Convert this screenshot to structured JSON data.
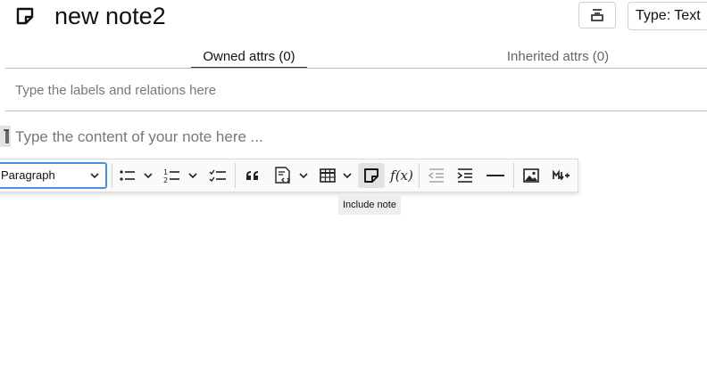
{
  "note": {
    "title": "new note2"
  },
  "header": {
    "type_button_label": "Type: Text"
  },
  "attributes": {
    "tabs": [
      {
        "label": "Owned attrs (0)"
      },
      {
        "label": "Inherited attrs (0)"
      }
    ],
    "input_placeholder": "Type the labels and relations here"
  },
  "editor": {
    "content_placeholder": "Type the content of your note here ...",
    "heading_select_value": "Paragraph",
    "formula_button_label": "f(x)",
    "tooltip": "Include note"
  },
  "icons": [
    "note-icon",
    "hoist-icon",
    "paragraph-marker-icon",
    "chevron-down-icon",
    "bulleted-list-icon",
    "numbered-list-icon",
    "todo-list-icon",
    "block-quote-icon",
    "code-block-icon",
    "table-icon",
    "include-note-icon",
    "math-icon",
    "outdent-icon",
    "indent-icon",
    "horizontal-line-icon",
    "image-icon",
    "markdown-icon"
  ]
}
